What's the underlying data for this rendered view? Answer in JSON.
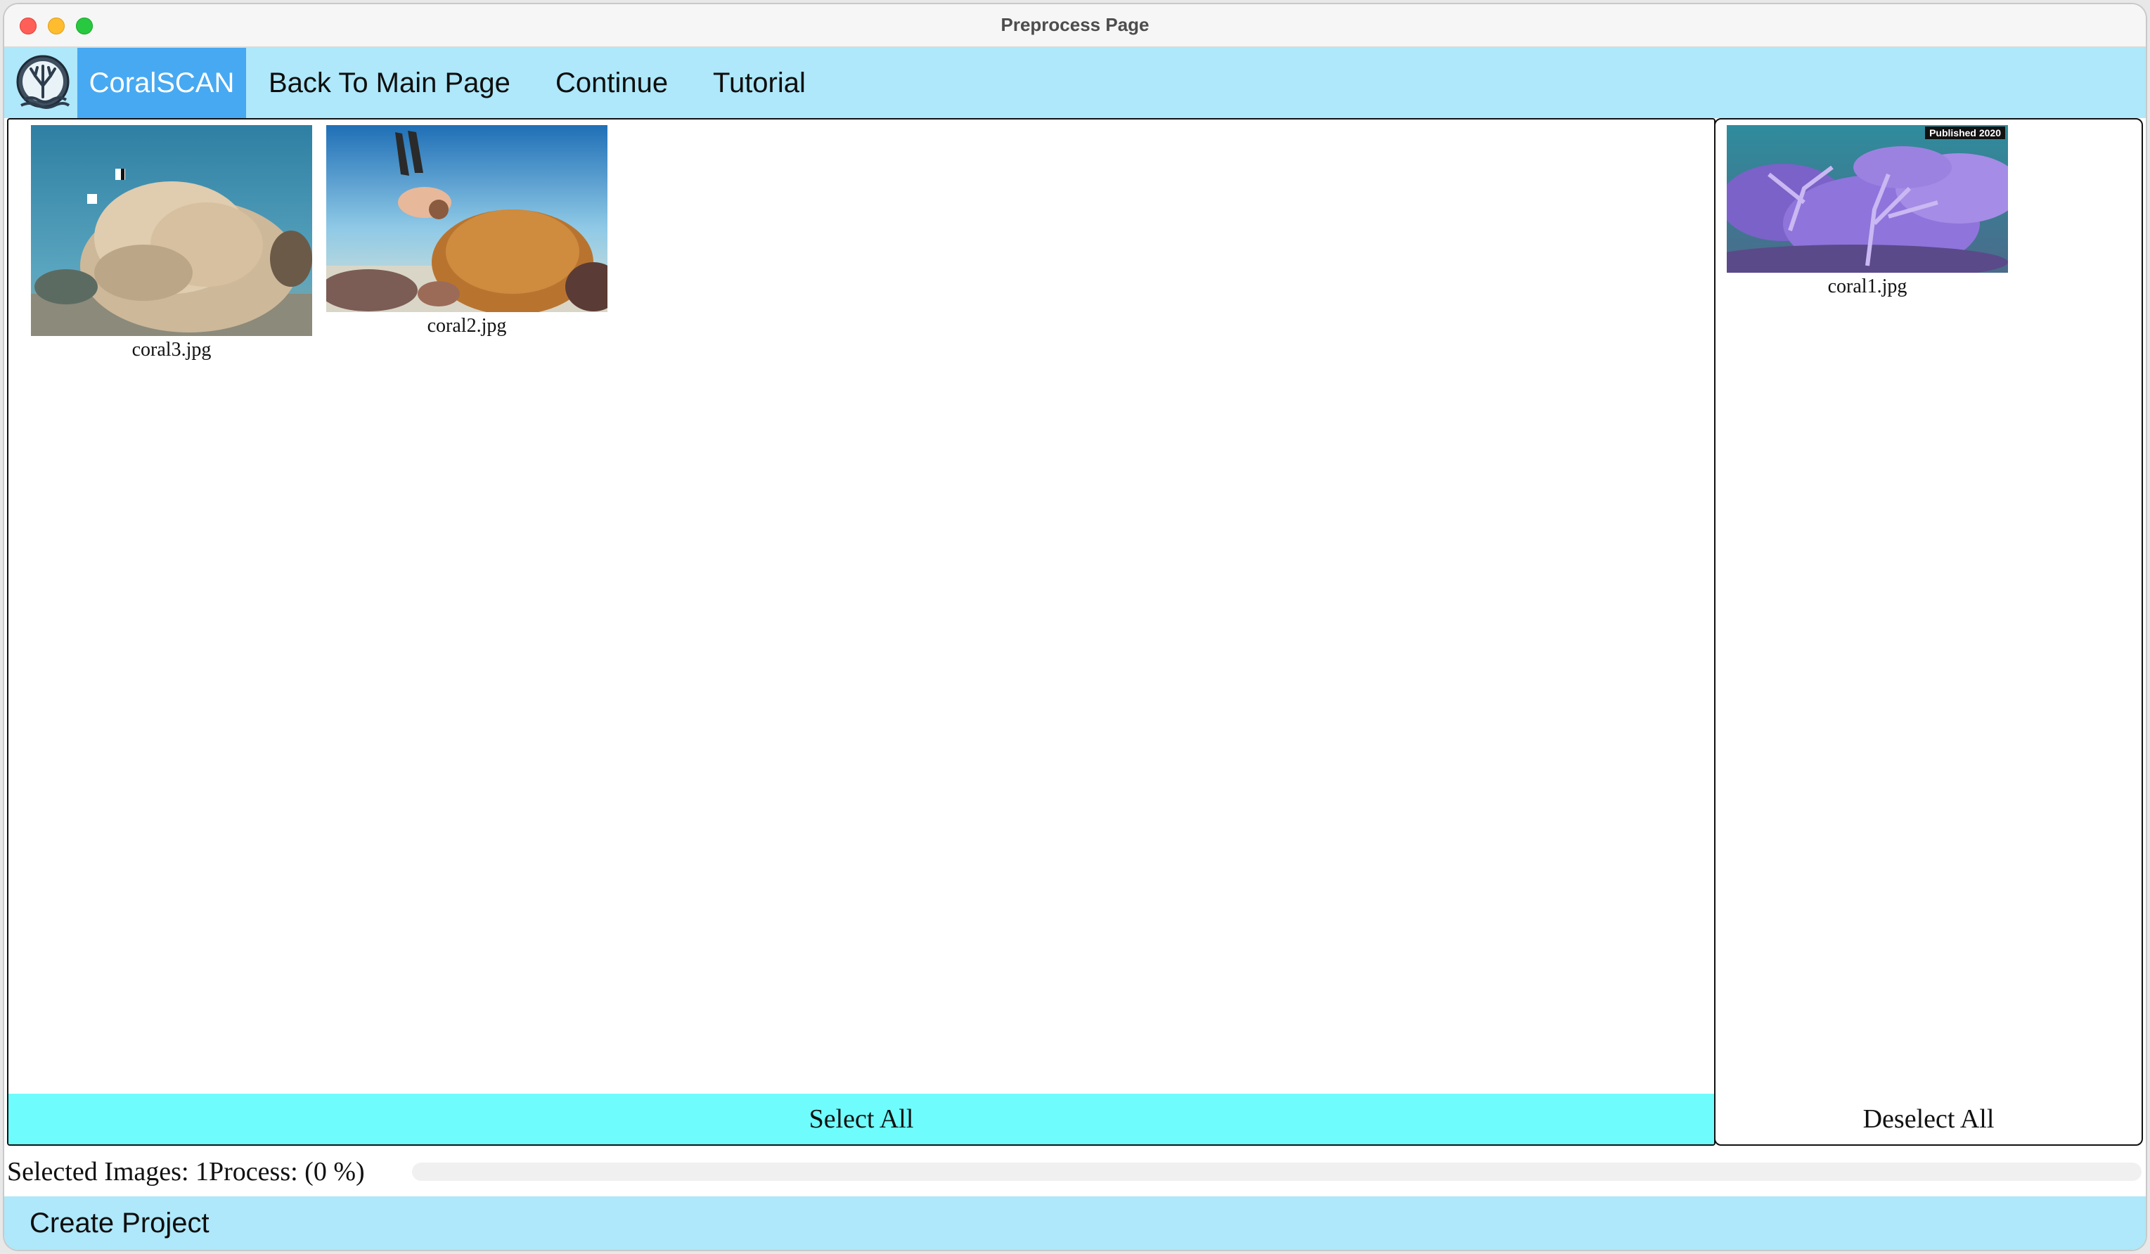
{
  "window": {
    "title": "Preprocess Page"
  },
  "menubar": {
    "brand": "CoralSCAN",
    "items": [
      "Back To Main Page",
      "Continue",
      "Tutorial"
    ]
  },
  "available_images": [
    {
      "filename": "coral3.jpg"
    },
    {
      "filename": "coral2.jpg"
    }
  ],
  "selected_images": [
    {
      "filename": "coral1.jpg",
      "badge": "Published 2020"
    }
  ],
  "buttons": {
    "select_all": "Select All",
    "deselect_all": "Deselect All",
    "create_project": "Create Project"
  },
  "status": {
    "text": "Selected Images: 1Process: (0 %)",
    "progress_percent": 0
  },
  "colors": {
    "menubar_bg": "#aee8fa",
    "brand_bg": "#47a9f2",
    "select_all_bg": "#6ffcfd"
  }
}
